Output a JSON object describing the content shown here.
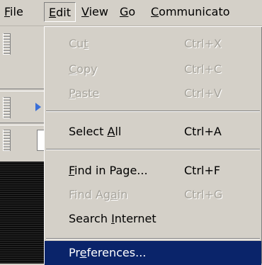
{
  "menubar": {
    "items": [
      {
        "label_pre": "",
        "label_ul": "F",
        "label_post": "ile"
      },
      {
        "label_pre": "",
        "label_ul": "E",
        "label_post": "dit"
      },
      {
        "label_pre": "",
        "label_ul": "V",
        "label_post": "iew"
      },
      {
        "label_pre": "",
        "label_ul": "G",
        "label_post": "o"
      },
      {
        "label_pre": "",
        "label_ul": "C",
        "label_post": "ommunicato"
      }
    ]
  },
  "edit_menu": {
    "items": [
      {
        "pre": "Cu",
        "ul": "t",
        "post": "",
        "shortcut": "Ctrl+X"
      },
      {
        "pre": "",
        "ul": "C",
        "post": "opy",
        "shortcut": "Ctrl+C"
      },
      {
        "pre": "",
        "ul": "P",
        "post": "aste",
        "shortcut": "Ctrl+V"
      },
      {
        "pre": "Select ",
        "ul": "A",
        "post": "ll",
        "shortcut": "Ctrl+A"
      },
      {
        "pre": "",
        "ul": "F",
        "post": "ind in Page...",
        "shortcut": "Ctrl+F"
      },
      {
        "pre": "Find Ag",
        "ul": "a",
        "post": "in",
        "shortcut": "Ctrl+G"
      },
      {
        "pre": "Search ",
        "ul": "I",
        "post": "nternet",
        "shortcut": ""
      },
      {
        "pre": "Pr",
        "ul": "e",
        "post": "ferences...",
        "shortcut": ""
      }
    ]
  }
}
